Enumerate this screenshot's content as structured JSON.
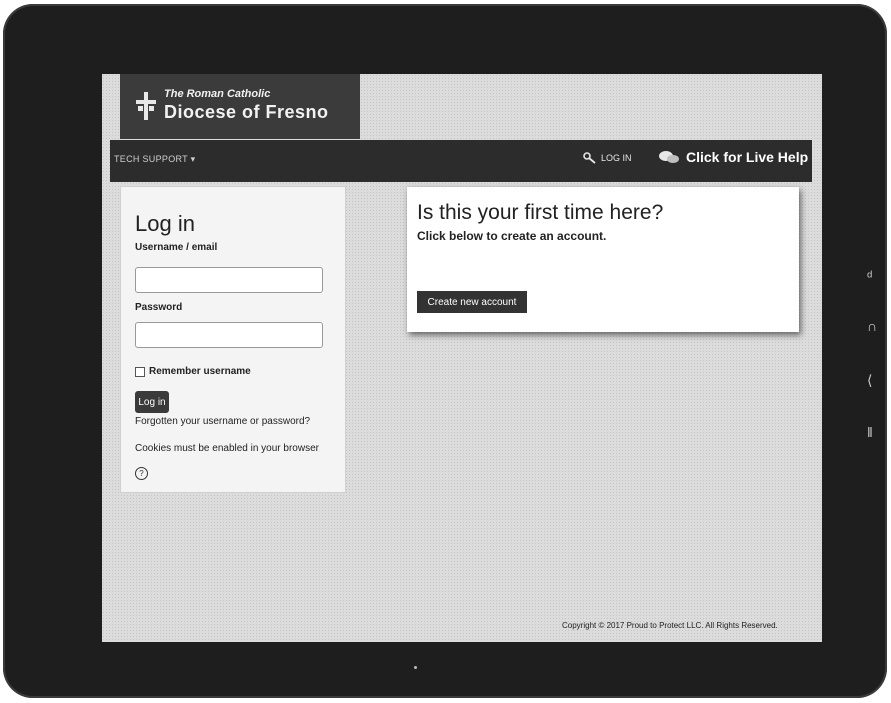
{
  "header": {
    "brand_small": "The Roman Catholic",
    "brand_large": "Diocese of Fresno"
  },
  "nav": {
    "tech_support": "TECH SUPPORT ▾",
    "login": "LOG IN",
    "live_help": "Click for Live Help"
  },
  "login": {
    "title": "Log in",
    "username_label": "Username / email",
    "password_label": "Password",
    "remember_label": "Remember username",
    "login_button": "Log in",
    "forgot_link": "Forgotten your username or password?",
    "cookies_text": "Cookies must be enabled in your browser"
  },
  "signup": {
    "title": "Is this your first time here?",
    "subtitle": "Click below to create an account.",
    "create_button": "Create new account"
  },
  "footer": {
    "copyright": "Copyright © 2017 Proud to Protect LLC. All Rights Reserved."
  },
  "icons": {
    "logo": "cross-logo-icon",
    "login": "key-icon",
    "help": "chat-icon",
    "info": "help-circle-icon"
  }
}
